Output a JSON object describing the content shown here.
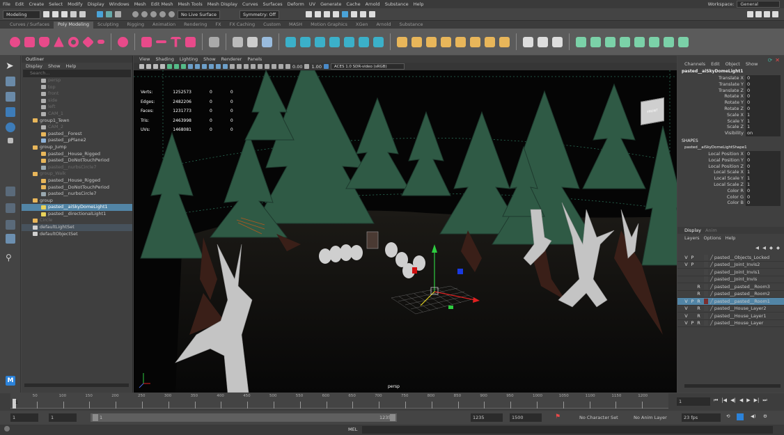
{
  "menu": [
    "File",
    "Edit",
    "Create",
    "Select",
    "Modify",
    "Display",
    "Windows",
    "Mesh",
    "Edit Mesh",
    "Mesh Tools",
    "Mesh Display",
    "Curves",
    "Surfaces",
    "Deform",
    "UV",
    "Generate",
    "Cache",
    "Arnold",
    "Substance",
    "Help"
  ],
  "workspace": {
    "label": "Workspace:",
    "value": "General"
  },
  "statusline": {
    "mode": "Modeling",
    "live": "No Live Surface",
    "symmetry": "Symmetry: Off"
  },
  "shelf_tabs": [
    "Curves / Surfaces",
    "Poly Modeling",
    "Sculpting",
    "Rigging",
    "Animation",
    "Rendering",
    "FX",
    "FX Caching",
    "Custom",
    "MASH",
    "Motion Graphics",
    "XGen",
    "Arnold",
    "Substance"
  ],
  "shelf_active": 1,
  "outliner": {
    "title": "Outliner",
    "menu": [
      "Display",
      "Show",
      "Help"
    ],
    "search": "Search...",
    "items": [
      {
        "label": "persp",
        "indent": 1,
        "type": "cam",
        "state": "dim"
      },
      {
        "label": "top",
        "indent": 1,
        "type": "cam",
        "state": "dim"
      },
      {
        "label": "front",
        "indent": 1,
        "type": "cam",
        "state": "dim"
      },
      {
        "label": "side",
        "indent": 1,
        "type": "cam",
        "state": "dim"
      },
      {
        "label": "left",
        "indent": 1,
        "type": "cam",
        "state": "dim"
      },
      {
        "label": "CAM_1",
        "indent": 1,
        "type": "cam",
        "state": "dim"
      },
      {
        "label": "group1_Tewn",
        "indent": 0,
        "type": "grp",
        "state": ""
      },
      {
        "label": "CAM_2",
        "indent": 1,
        "type": "cam",
        "state": "dim"
      },
      {
        "label": "pasted__Forest",
        "indent": 1,
        "type": "grp",
        "state": ""
      },
      {
        "label": "pasted__pPlane2",
        "indent": 1,
        "type": "mesh",
        "state": ""
      },
      {
        "label": "group_Jump",
        "indent": 0,
        "type": "grp",
        "state": ""
      },
      {
        "label": "pasted__House_Rigged",
        "indent": 1,
        "type": "grp",
        "state": ""
      },
      {
        "label": "pasted__DoNotTouchPeriod",
        "indent": 1,
        "type": "grp",
        "state": ""
      },
      {
        "label": "pasted__nurbsCircle7",
        "indent": 1,
        "type": "curve",
        "state": "dim"
      },
      {
        "label": "group_Walk",
        "indent": 0,
        "type": "grp",
        "state": "dim"
      },
      {
        "label": "pasted__House_Rigged",
        "indent": 1,
        "type": "grp",
        "state": ""
      },
      {
        "label": "pasted__DoNotTouchPeriod",
        "indent": 1,
        "type": "grp",
        "state": ""
      },
      {
        "label": "pasted__nurbsCircle7",
        "indent": 1,
        "type": "curve",
        "state": ""
      },
      {
        "label": "group",
        "indent": 0,
        "type": "grp",
        "state": ""
      },
      {
        "label": "pasted__aiSkyDomeLight1",
        "indent": 1,
        "type": "light",
        "state": "sel"
      },
      {
        "label": "pasted__directionalLight1",
        "indent": 1,
        "type": "light",
        "state": ""
      },
      {
        "label": "Circle",
        "indent": 0,
        "type": "grp",
        "state": "dim"
      },
      {
        "label": "defaultLightSet",
        "indent": 0,
        "type": "set",
        "state": "hl"
      },
      {
        "label": "defaultObjectSet",
        "indent": 0,
        "type": "set",
        "state": ""
      }
    ]
  },
  "viewport": {
    "menu": [
      "View",
      "Shading",
      "Lighting",
      "Show",
      "Renderer",
      "Panels"
    ],
    "camera": "persp",
    "exposure": "0.00",
    "gamma": "1.00",
    "colorspace": "ACES 1.0 SDR-video (sRGB)",
    "cube_label": "FRONT",
    "hud": [
      {
        "label": "Verts:",
        "a": "1252573",
        "b": "0",
        "c": "0"
      },
      {
        "label": "Edges:",
        "a": "2482206",
        "b": "0",
        "c": "0"
      },
      {
        "label": "Faces:",
        "a": "1231773",
        "b": "0",
        "c": "0"
      },
      {
        "label": "Tris:",
        "a": "2463998",
        "b": "0",
        "c": "0"
      },
      {
        "label": "UVs:",
        "a": "1468081",
        "b": "0",
        "c": "0"
      }
    ]
  },
  "channels": {
    "menu": [
      "Channels",
      "Edit",
      "Object",
      "Show"
    ],
    "object": "pasted__aiSkyDomeLight1",
    "attrs": [
      {
        "name": "Translate X",
        "value": "0"
      },
      {
        "name": "Translate Y",
        "value": "0"
      },
      {
        "name": "Translate Z",
        "value": "0"
      },
      {
        "name": "Rotate X",
        "value": "0"
      },
      {
        "name": "Rotate Y",
        "value": "0"
      },
      {
        "name": "Rotate Z",
        "value": "0"
      },
      {
        "name": "Scale X",
        "value": "1"
      },
      {
        "name": "Scale Y",
        "value": "1"
      },
      {
        "name": "Scale Z",
        "value": "1"
      },
      {
        "name": "Visibility",
        "value": "on"
      }
    ],
    "shapes_header": "SHAPES",
    "shape": "pasted__aiSkyDomeLightShape1",
    "shape_attrs": [
      {
        "name": "Local Position X",
        "value": "0"
      },
      {
        "name": "Local Position Y",
        "value": "0"
      },
      {
        "name": "Local Position Z",
        "value": "0"
      },
      {
        "name": "Local Scale X",
        "value": "1"
      },
      {
        "name": "Local Scale Y",
        "value": "1"
      },
      {
        "name": "Local Scale Z",
        "value": "1"
      },
      {
        "name": "Color R",
        "value": "0"
      },
      {
        "name": "Color G",
        "value": "0"
      },
      {
        "name": "Color B",
        "value": "0"
      }
    ]
  },
  "layers": {
    "tabs": [
      "Display",
      "Anim"
    ],
    "menu": [
      "Layers",
      "Options",
      "Help"
    ],
    "items": [
      {
        "v": "V",
        "p": "P",
        "r": "",
        "name": "pasted__Objects_Locked",
        "color": "#444444",
        "sel": false
      },
      {
        "v": "V",
        "p": "P",
        "r": "",
        "name": "pasted__Joint_Invis2",
        "color": "#444444",
        "sel": false
      },
      {
        "v": "",
        "p": "",
        "r": "",
        "name": "pasted__Joint_Invis1",
        "color": "#444444",
        "sel": false
      },
      {
        "v": "",
        "p": "",
        "r": "",
        "name": "pasted__Joint_Invis",
        "color": "#444444",
        "sel": false
      },
      {
        "v": "",
        "p": "",
        "r": "R",
        "name": "pasted__pasted__Room3",
        "color": "#444444",
        "sel": false
      },
      {
        "v": "",
        "p": "",
        "r": "R",
        "name": "pasted__pasted__Room2",
        "color": "#444444",
        "sel": false
      },
      {
        "v": "V",
        "p": "P",
        "r": "R",
        "name": "pasted__pasted__Room1",
        "color": "#7a2e2e",
        "sel": true
      },
      {
        "v": "V",
        "p": "",
        "r": "R",
        "name": "pasted__House_Layer2",
        "color": "#444444",
        "sel": false
      },
      {
        "v": "V",
        "p": "",
        "r": "R",
        "name": "pasted__House_Layer1",
        "color": "#444444",
        "sel": false
      },
      {
        "v": "V",
        "p": "P",
        "r": "R",
        "name": "pasted__House_Layer",
        "color": "#444444",
        "sel": false
      }
    ]
  },
  "timeline": {
    "ticks": [
      "50",
      "100",
      "150",
      "200",
      "250",
      "300",
      "350",
      "400",
      "450",
      "500",
      "550",
      "600",
      "650",
      "700",
      "750",
      "800",
      "850",
      "900",
      "950",
      "1000",
      "1050",
      "1100",
      "1150",
      "1200"
    ],
    "current": "1",
    "current_right": "1"
  },
  "range": {
    "start": "1",
    "start2": "1",
    "slider_start": "1",
    "slider_end": "1235",
    "end": "1235",
    "end2": "1500",
    "charset": "No Character Set",
    "animlayer": "No Anim Layer",
    "fps": "23 fps"
  },
  "cmd": {
    "label": "MEL"
  },
  "colors": {
    "selection": "#5285a6",
    "tree": "#2f5a45",
    "trunk": "#4a2a20",
    "bark": "#c9c9c9"
  }
}
